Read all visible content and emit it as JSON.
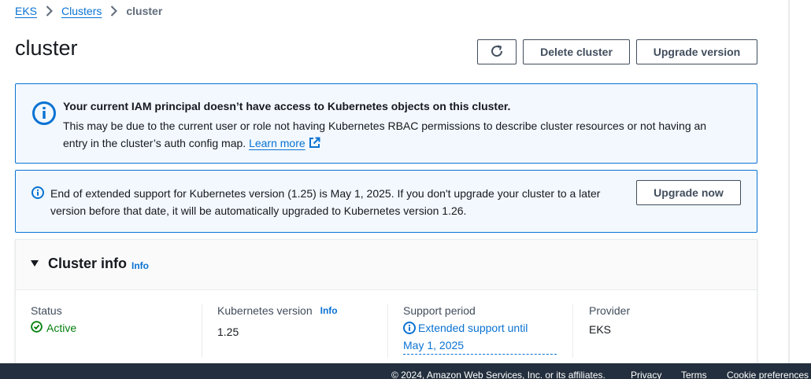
{
  "breadcrumb": {
    "items": [
      "EKS",
      "Clusters"
    ],
    "current": "cluster"
  },
  "page": {
    "title": "cluster"
  },
  "actions": {
    "delete_label": "Delete cluster",
    "upgrade_label": "Upgrade version",
    "refresh_icon": "refresh-icon"
  },
  "alerts": {
    "iam": {
      "title": "Your current IAM principal doesn’t have access to Kubernetes objects on this cluster.",
      "body_line1": "This may be due to the current user or role not having Kubernetes RBAC permissions to describe cluster resources or not having an",
      "body_line2": "entry in the cluster’s auth config map.",
      "link": "Learn more"
    },
    "support": {
      "line1": "End of extended support for Kubernetes version (1.25) is May 1, 2025. If you don't upgrade your cluster to a later",
      "line2": "version before that date, it will be automatically upgraded to Kubernetes version 1.26.",
      "button": "Upgrade now"
    }
  },
  "cluster_info": {
    "title": "Cluster info",
    "info": "Info",
    "fields": {
      "status": {
        "label": "Status",
        "value": "Active"
      },
      "k8s_version": {
        "label": "Kubernetes version",
        "info": "Info",
        "value": "1.25"
      },
      "support_period": {
        "label": "Support period",
        "line1": "Extended support until",
        "line2": "May 1, 2025"
      },
      "provider": {
        "label": "Provider",
        "value": "EKS"
      }
    }
  },
  "footer": {
    "copyright": "© 2024, Amazon Web Services, Inc. or its affiliates.",
    "privacy": "Privacy",
    "terms": "Terms",
    "cookies": "Cookie preferences"
  },
  "colors": {
    "link": "#0972d3",
    "success": "#037f0c",
    "footer_bg": "#232f3e",
    "alert_bg": "#f2f8fd"
  }
}
